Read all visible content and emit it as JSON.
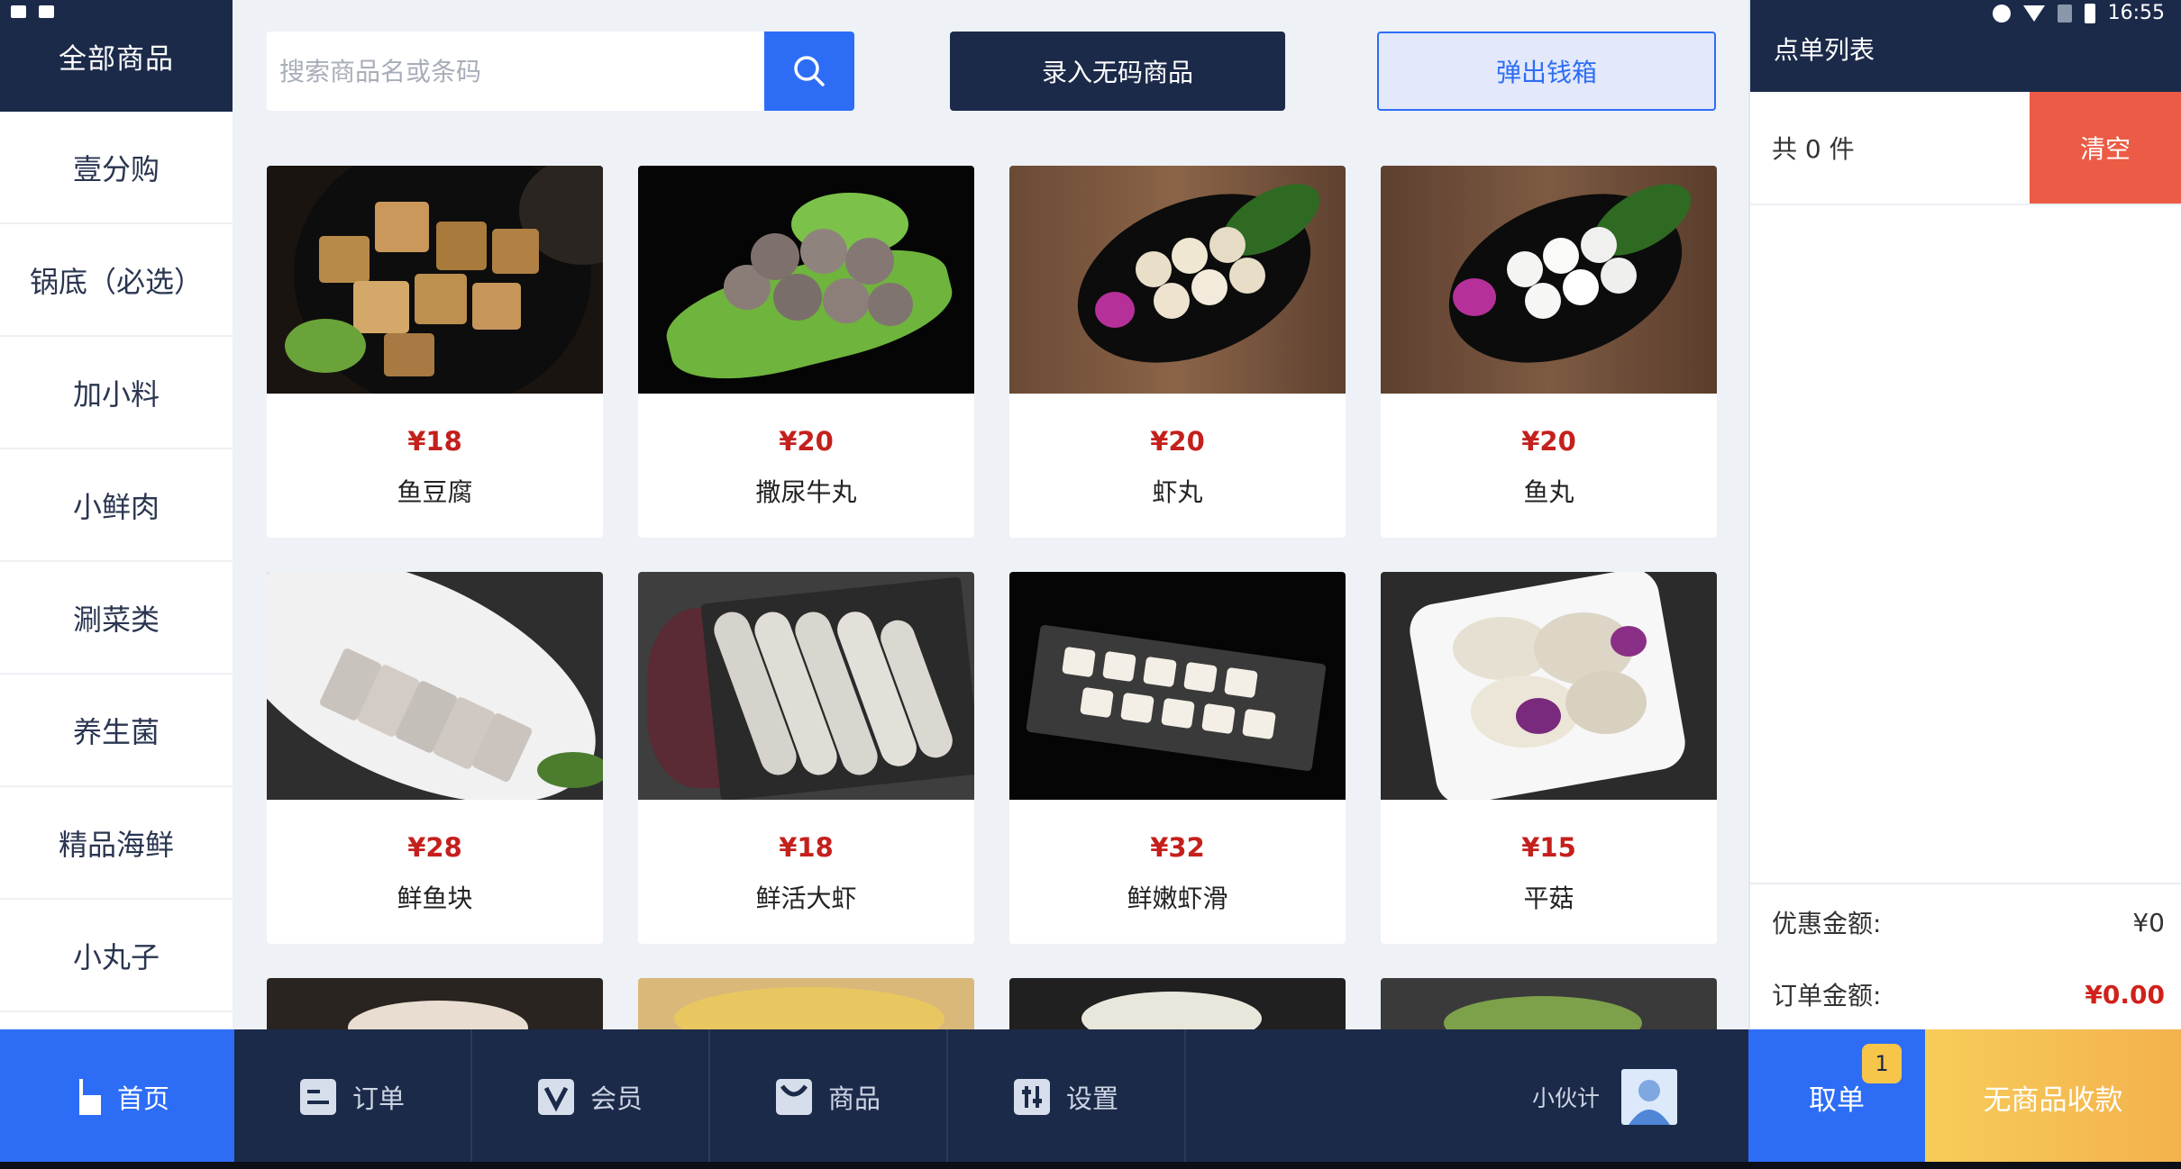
{
  "status_bar": {
    "time": "16:55"
  },
  "sidebar": {
    "title": "全部商品",
    "items": [
      {
        "label": "壹分购"
      },
      {
        "label": "锅底（必选）"
      },
      {
        "label": "加小料"
      },
      {
        "label": "小鲜肉"
      },
      {
        "label": "涮菜类"
      },
      {
        "label": "养生菌"
      },
      {
        "label": "精品海鲜"
      },
      {
        "label": "小丸子"
      }
    ]
  },
  "toolbar": {
    "search_placeholder": "搜索商品名或条码",
    "nocode_label": "录入无码商品",
    "drawer_label": "弹出钱箱"
  },
  "products": [
    {
      "price": "¥18",
      "name": "鱼豆腐",
      "image": "fish-tofu"
    },
    {
      "price": "¥20",
      "name": "撒尿牛丸",
      "image": "beef-balls"
    },
    {
      "price": "¥20",
      "name": "虾丸",
      "image": "shrimp-balls"
    },
    {
      "price": "¥20",
      "name": "鱼丸",
      "image": "fish-balls"
    },
    {
      "price": "¥28",
      "name": "鲜鱼块",
      "image": "fish-slices"
    },
    {
      "price": "¥18",
      "name": "鲜活大虾",
      "image": "prawns"
    },
    {
      "price": "¥32",
      "name": "鲜嫩虾滑",
      "image": "shrimp-paste"
    },
    {
      "price": "¥15",
      "name": "平菇",
      "image": "oyster-mushroom"
    }
  ],
  "order_panel": {
    "title": "点单列表",
    "count_text": "共 0 件",
    "clear_label": "清空",
    "discount_label": "优惠金额:",
    "discount_value": "¥0",
    "total_label": "订单金额:",
    "total_value": "¥0.00"
  },
  "bottom_nav": {
    "items": [
      {
        "label": "首页",
        "icon": "home-icon"
      },
      {
        "label": "订单",
        "icon": "order-icon"
      },
      {
        "label": "会员",
        "icon": "member-icon"
      },
      {
        "label": "商品",
        "icon": "goods-icon"
      },
      {
        "label": "设置",
        "icon": "settings-icon"
      }
    ],
    "staff_name": "小伙计",
    "take_order_label": "取单",
    "take_order_badge": "1",
    "pay_label": "无商品收款"
  },
  "colors": {
    "navy": "#1c2a4a",
    "blue": "#2d6df6",
    "price_red": "#c4201d",
    "clear_red": "#eb5b45",
    "pay_yellow": "#f5c152"
  }
}
